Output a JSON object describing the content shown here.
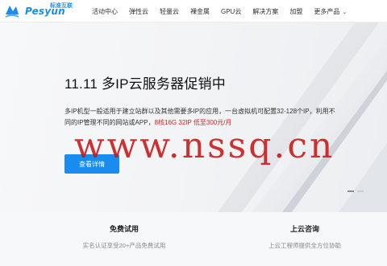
{
  "brand": {
    "name": "Pesyun",
    "tagline": "标准互联",
    "accent_color": "#1a8cf0"
  },
  "nav": {
    "items": [
      {
        "label": "活动中心"
      },
      {
        "label": "弹性云"
      },
      {
        "label": "轻量云"
      },
      {
        "label": "裸金属"
      },
      {
        "label": "GPU云"
      },
      {
        "label": "解决方案"
      },
      {
        "label": "加盟"
      },
      {
        "label": "更多产品",
        "icon": "chevron-down-icon"
      }
    ]
  },
  "hero": {
    "title": "11.11 多IP云服务器促销中",
    "description": "多IP机型一般适用于建立站群以及其他需要多IP的应用，一台虚拟机可配置32-128个IP，利用不同的IP管理不同的网站或APP，",
    "highlight": "8核16G 32IP 低至300元/月",
    "cta_label": "查看详情",
    "watermark": "www.nssq.cn",
    "carousel": {
      "total": 2,
      "active": 1
    }
  },
  "features": [
    {
      "title": "免费试用",
      "desc": "实名认证享受20+产品免费试用"
    },
    {
      "title": "上云咨询",
      "desc": "上云工程师提供全方位协助"
    }
  ]
}
